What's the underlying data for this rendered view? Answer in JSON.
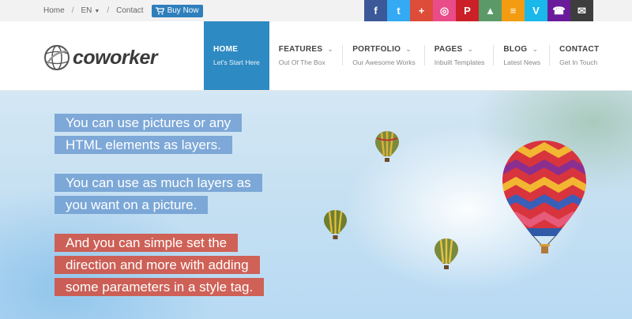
{
  "topbar": {
    "home": "Home",
    "language": "EN",
    "contact": "Contact",
    "buy_now": "Buy Now",
    "separator": "/",
    "social": [
      {
        "icon": "facebook-icon",
        "glyph": "f",
        "color": "#3b5998"
      },
      {
        "icon": "twitter-icon",
        "glyph": "t",
        "color": "#33aaf3"
      },
      {
        "icon": "google-plus-icon",
        "glyph": "+",
        "color": "#dd4b39"
      },
      {
        "icon": "dribbble-icon",
        "glyph": "◎",
        "color": "#ea4c89"
      },
      {
        "icon": "pinterest-icon",
        "glyph": "P",
        "color": "#cb2027"
      },
      {
        "icon": "forrst-icon",
        "glyph": "▲",
        "color": "#5b9a68"
      },
      {
        "icon": "rss-icon",
        "glyph": "≡",
        "color": "#f39c12"
      },
      {
        "icon": "vimeo-icon",
        "glyph": "V",
        "color": "#1ab7ea"
      },
      {
        "icon": "phone-icon",
        "glyph": "☎",
        "color": "#6a1b9a"
      },
      {
        "icon": "email-icon",
        "glyph": "✉",
        "color": "#3d3d3d"
      }
    ]
  },
  "logo": {
    "text": "coworker"
  },
  "nav": [
    {
      "title": "HOME",
      "sub": "Let's Start Here",
      "active": true
    },
    {
      "title": "FEATURES",
      "sub": "Out Of The Box",
      "chevron": true
    },
    {
      "title": "PORTFOLIO",
      "sub": "Our Awesome Works",
      "chevron": true
    },
    {
      "title": "PAGES",
      "sub": "Inbuilt Templates",
      "chevron": true
    },
    {
      "title": "BLOG",
      "sub": "Latest News",
      "chevron": true
    },
    {
      "title": "CONTACT",
      "sub": "Get In Touch"
    }
  ],
  "hero": {
    "lines": [
      "You can use pictures or any",
      "HTML elements as layers.",
      "You can use as much layers as",
      "you want on a picture.",
      "And you can simple set the",
      "direction and more with adding",
      "some parameters in a style tag."
    ]
  },
  "colors": {
    "accent": "#2e8ac2",
    "caption_blue": "#6e9ed2",
    "caption_red": "#d25041"
  }
}
